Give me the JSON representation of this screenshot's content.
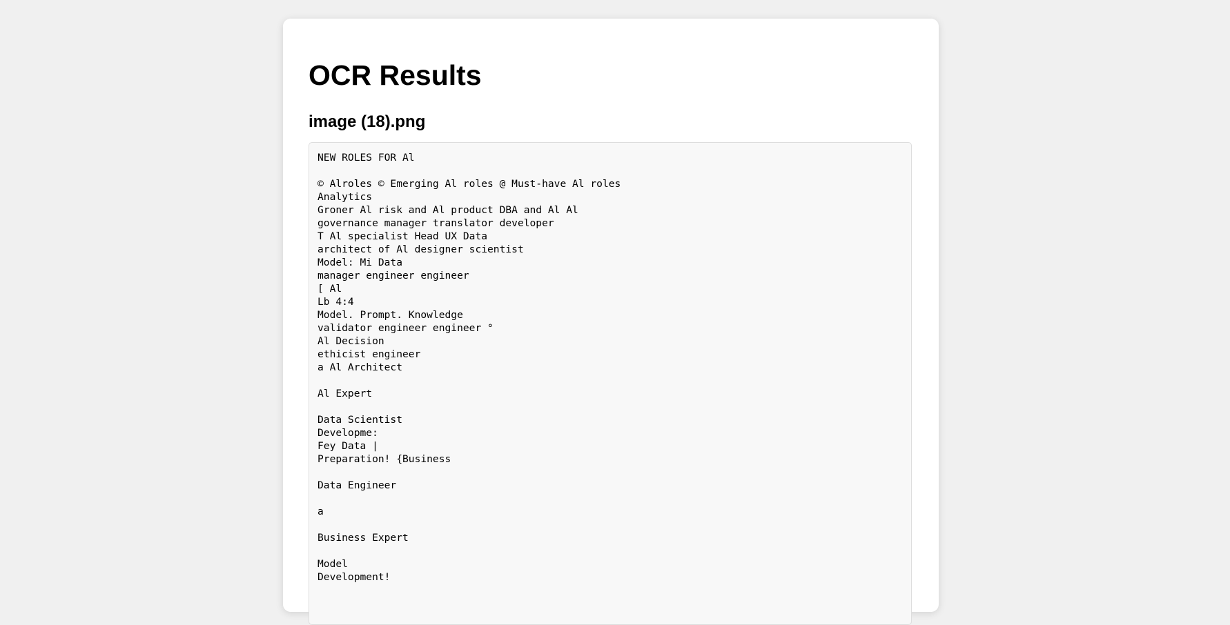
{
  "page": {
    "title": "OCR Results"
  },
  "result": {
    "file_name": "image (18).png",
    "text": "NEW ROLES FOR Al\n\n© Alroles © Emerging Al roles @ Must-have Al roles\nAnalytics\nGroner Al risk and Al product DBA and Al Al\ngovernance manager translator developer\nT Al specialist Head UX Data\narchitect of Al designer scientist\nModel: Mi Data\nmanager engineer engineer\n[ Al\nLb 4:4\nModel. Prompt. Knowledge\nvalidator engineer engineer °\nAl Decision\nethicist engineer\na Al Architect\n\nAl Expert\n\nData Scientist\nDevelopme:\nFey Data |\nPreparation! {Business\n\nData Engineer\n\na\n\nBusiness Expert\n\nModel\nDevelopment!"
  }
}
